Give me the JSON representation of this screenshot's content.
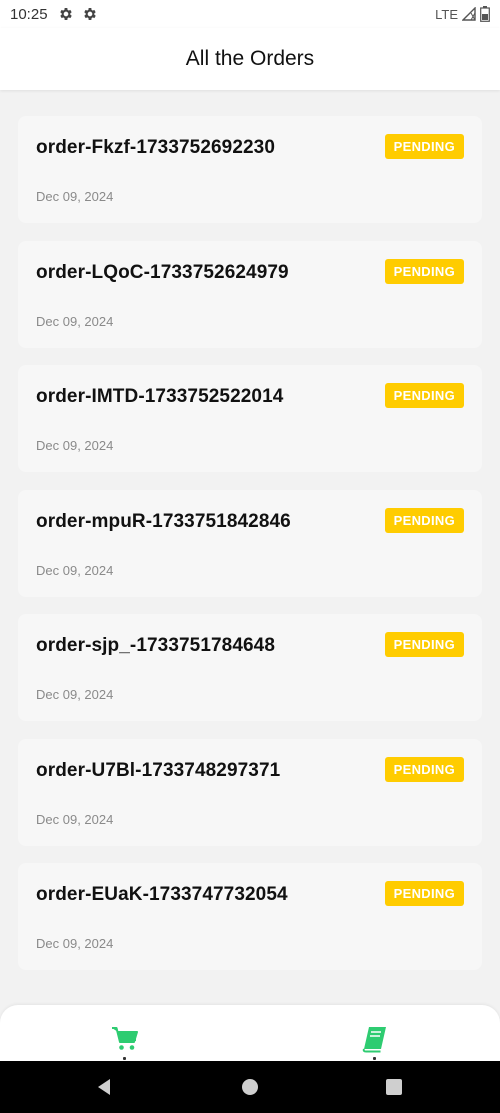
{
  "status_bar": {
    "time": "10:25",
    "network": "LTE",
    "icons": [
      "gear-icon",
      "gear-icon",
      "signal-icon",
      "battery-icon"
    ]
  },
  "header": {
    "title": "All the Orders"
  },
  "orders": [
    {
      "id": "order-Fkzf-1733752692230",
      "status": "PENDING",
      "date": "Dec 09, 2024"
    },
    {
      "id": "order-LQoC-1733752624979",
      "status": "PENDING",
      "date": "Dec 09, 2024"
    },
    {
      "id": "order-IMTD-1733752522014",
      "status": "PENDING",
      "date": "Dec 09, 2024"
    },
    {
      "id": "order-mpuR-1733751842846",
      "status": "PENDING",
      "date": "Dec 09, 2024"
    },
    {
      "id": "order-sjp_-1733751784648",
      "status": "PENDING",
      "date": "Dec 09, 2024"
    },
    {
      "id": "order-U7Bl-1733748297371",
      "status": "PENDING",
      "date": "Dec 09, 2024"
    },
    {
      "id": "order-EUaK-1733747732054",
      "status": "PENDING",
      "date": "Dec 09, 2024"
    }
  ],
  "tab_bar": {
    "tabs": [
      {
        "icon": "cart-icon"
      },
      {
        "icon": "book-icon"
      }
    ]
  },
  "colors": {
    "accent": "#2ecc71",
    "badge": "#ffcc00",
    "card": "#f7f7f7",
    "background": "#f2f2f2"
  },
  "nav_bar": {
    "buttons": [
      "back-icon",
      "home-icon",
      "recents-icon"
    ]
  }
}
